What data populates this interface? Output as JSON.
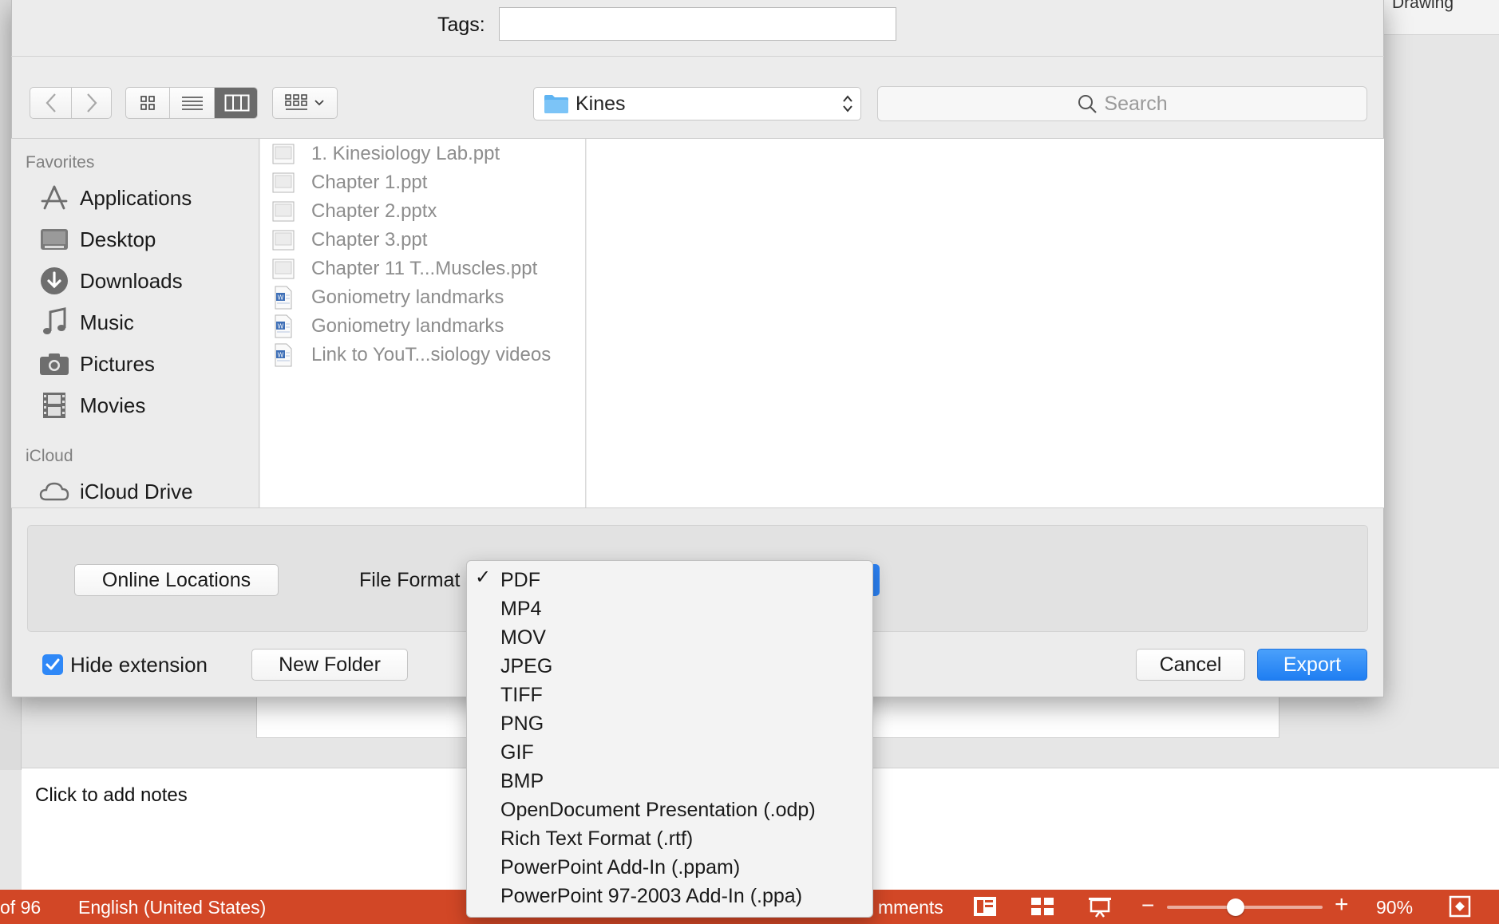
{
  "app": {
    "ribbon_tab_partial": "Drawing",
    "notes_placeholder": "Click to add notes",
    "status": {
      "slide_count_partial": "of 96",
      "language": "English (United States)",
      "comments_partial": "mments",
      "zoom_level": "90%",
      "zoom_fraction": 0.4
    }
  },
  "dialog": {
    "tags_label": "Tags:",
    "tags_value": "",
    "current_folder": "Kines",
    "search_placeholder": "Search",
    "sidebar": {
      "favorites_heading": "Favorites",
      "favorites": [
        {
          "label": "Applications",
          "icon": "applications-icon"
        },
        {
          "label": "Desktop",
          "icon": "desktop-icon"
        },
        {
          "label": "Downloads",
          "icon": "downloads-icon"
        },
        {
          "label": "Music",
          "icon": "music-icon"
        },
        {
          "label": "Pictures",
          "icon": "pictures-icon"
        },
        {
          "label": "Movies",
          "icon": "movies-icon"
        }
      ],
      "icloud_heading": "iCloud",
      "icloud": [
        {
          "label": "iCloud Drive",
          "icon": "cloud-icon"
        }
      ]
    },
    "files": [
      {
        "name": "1. Kinesiology Lab.ppt",
        "icon": "ppt-file-icon"
      },
      {
        "name": "Chapter 1.ppt",
        "icon": "ppt-file-icon"
      },
      {
        "name": "Chapter 2.pptx",
        "icon": "ppt-file-icon"
      },
      {
        "name": "Chapter 3.ppt",
        "icon": "ppt-file-icon"
      },
      {
        "name": "Chapter 11 T...Muscles.ppt",
        "icon": "ppt-file-icon"
      },
      {
        "name": "Goniometry landmarks",
        "icon": "word-file-icon"
      },
      {
        "name": "Goniometry landmarks",
        "icon": "word-file-icon"
      },
      {
        "name": "Link to YouT...siology videos",
        "icon": "word-file-icon"
      }
    ],
    "online_locations_label": "Online Locations",
    "file_format_label": "File Format",
    "hide_extension_label": "Hide extension",
    "hide_extension_checked": true,
    "new_folder_label": "New Folder",
    "cancel_label": "Cancel",
    "export_label": "Export",
    "format_menu": {
      "selected": "PDF",
      "options": [
        "PDF",
        "MP4",
        "MOV",
        "JPEG",
        "TIFF",
        "PNG",
        "GIF",
        "BMP",
        "OpenDocument Presentation (.odp)",
        "Rich Text Format (.rtf)",
        "PowerPoint Add-In (.ppam)",
        "PowerPoint 97-2003 Add-In (.ppa)"
      ]
    }
  },
  "colors": {
    "accent_blue": "#2f88f7",
    "status_bar": "#d24726",
    "view_active": "#6b6b6b"
  }
}
